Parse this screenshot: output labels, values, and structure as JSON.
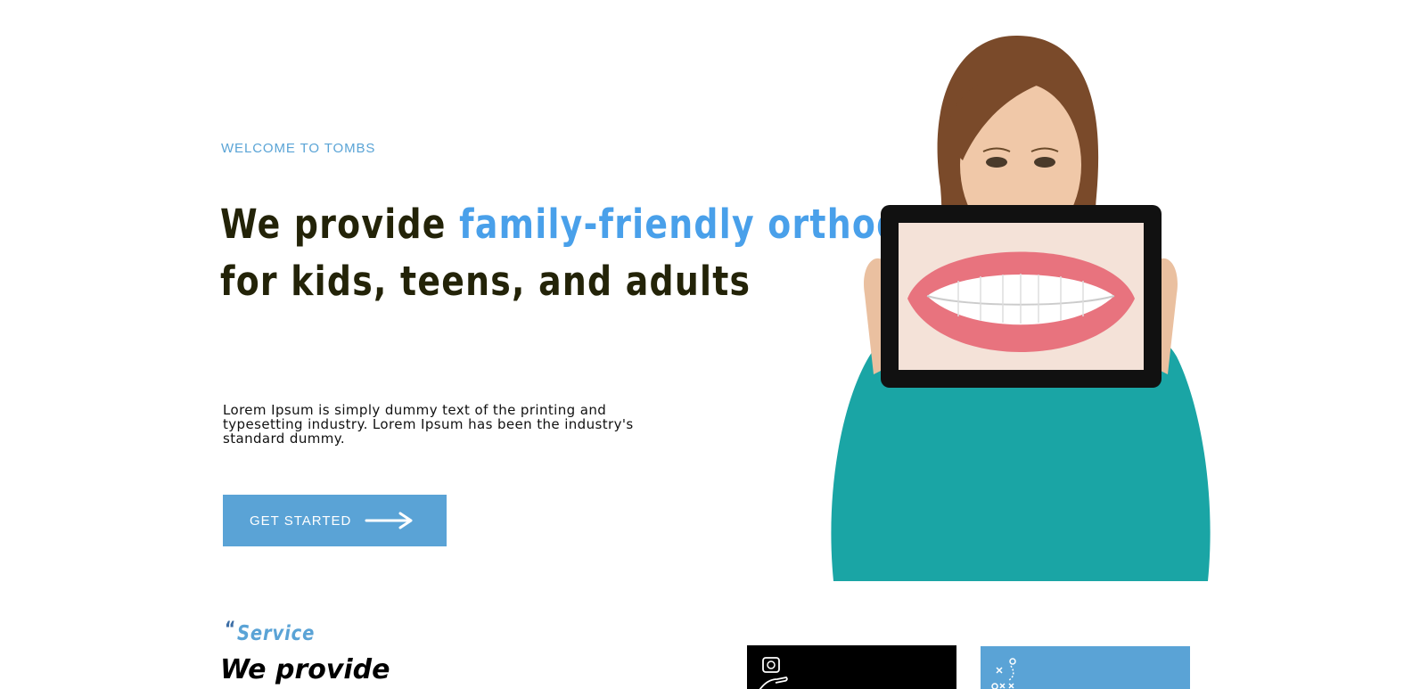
{
  "hero": {
    "welcome": "WELCOME TO TOMBS",
    "headline": {
      "part1": "We provide ",
      "part2": "family-friendly orthodontics",
      "part3": "for kids, teens, and adults"
    },
    "intro": "Lorem Ipsum is simply dummy text of the printing and typesetting industry. Lorem Ipsum has been the industry's standard dummy.",
    "cta_label": "GET STARTED"
  },
  "service": {
    "quote_mark": "“",
    "tag": "Service",
    "title": "We provide"
  },
  "colors": {
    "accent": "#5aa3d6",
    "headline_blue": "#49a0ea",
    "headline_dark": "#232308",
    "sweater": "#1aa5a5"
  },
  "icons": [
    "arrow-right-icon",
    "tooth-care-icon",
    "strategy-icon"
  ]
}
